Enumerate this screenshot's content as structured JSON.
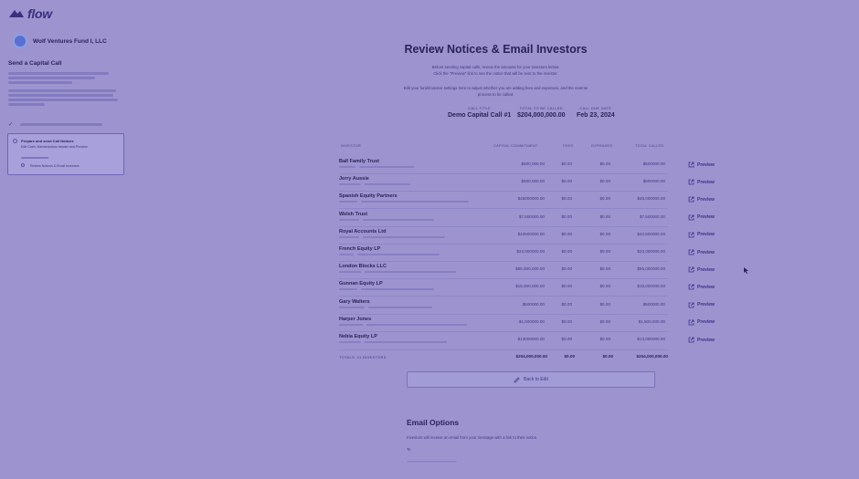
{
  "app": {
    "logo_text": "flow",
    "fund_name": "Wolf Ventures Fund I, LLC"
  },
  "sidebar": {
    "title": "Send a Capital Call",
    "steps": [
      {
        "label": "Prepare and send Call Notices",
        "sub": "Edit Cash, Memorandum header and Preview"
      },
      {
        "label": "Review Notices & Email Investors"
      }
    ]
  },
  "page": {
    "title": "Review Notices & Email Investors",
    "intro_line1": "Before sending capital calls, review the amounts for your investors below.",
    "intro_line2": "Click the \"Preview\" link to see the notice that will be sent to the investor.",
    "intro_line3": "Edit your fund/investor settings here to adjust whether you are adding fees and expenses, and the reverse",
    "intro_line4": "process to be called."
  },
  "summary": [
    {
      "key": "CALL TITLE",
      "value": "Demo Capital Call #1"
    },
    {
      "key": "TOTAL TO BE CALLED",
      "value": "$204,000,000.00"
    },
    {
      "key": "CALL DUE DATE",
      "value": "Feb 23, 2024"
    }
  ],
  "table": {
    "headers": {
      "investor": "INVESTOR",
      "capital": "CAPITAL COMMITMENT",
      "fees": "FEES",
      "expenses": "EXPENSES",
      "total": "TOTAL CALLED"
    },
    "preview_label": "Preview",
    "rows": [
      {
        "name": "Ball Family Trust",
        "capital": "$500,000.00",
        "fees": "$0.00",
        "expenses": "$0.00",
        "total": "$500000.00"
      },
      {
        "name": "Jerry Aussie",
        "capital": "$500,000.00",
        "fees": "$0.00",
        "expenses": "$0.00",
        "total": "$500000.00"
      },
      {
        "name": "Spanish Equity Partners",
        "capital": "$45000000.00",
        "fees": "$0.00",
        "expenses": "$0.00",
        "total": "$45,000000.00"
      },
      {
        "name": "Welsh Trust",
        "capital": "$7,500000.00",
        "fees": "$0.00",
        "expenses": "$0.00",
        "total": "$7,500000.00"
      },
      {
        "name": "Royal Accounts Ltd",
        "capital": "$42500000.00",
        "fees": "$0.00",
        "expenses": "$0.00",
        "total": "$42,500000.00"
      },
      {
        "name": "French Equity LP",
        "capital": "$22,000000.00",
        "fees": "$0.00",
        "expenses": "$0.00",
        "total": "$22,000000.00"
      },
      {
        "name": "London Blocks LLC",
        "capital": "$55,000,000.00",
        "fees": "$0.00",
        "expenses": "$0.00",
        "total": "$55,000000.00"
      },
      {
        "name": "Gunnan Equity LP",
        "capital": "$15,000,000.00",
        "fees": "$0.00",
        "expenses": "$0.00",
        "total": "$15,000000.00"
      },
      {
        "name": "Gary Walters",
        "capital": "$500000.00",
        "fees": "$0.00",
        "expenses": "$0.00",
        "total": "$500000.00"
      },
      {
        "name": "Harper Jones",
        "capital": "$1,500000.00",
        "fees": "$0.00",
        "expenses": "$0.00",
        "total": "$1,500,000.00"
      },
      {
        "name": "Nebia Equity LP",
        "capital": "$13000000.00",
        "fees": "$0.00",
        "expenses": "$0.00",
        "total": "$13,000000.00"
      }
    ],
    "totals": {
      "label": "TOTALS: 11 INVESTORS",
      "capital": "$204,000,000.00",
      "fees": "$0.00",
      "expenses": "$0.00",
      "total": "$204,000,000.00"
    }
  },
  "back_button": "Back to Edit",
  "email": {
    "title": "Email Options",
    "description": "Investors will receive an email from your message with a link to their notice.",
    "to_label": "To"
  },
  "colors": {
    "overlay": "#9d94cf",
    "brand": "#3a2f80"
  }
}
